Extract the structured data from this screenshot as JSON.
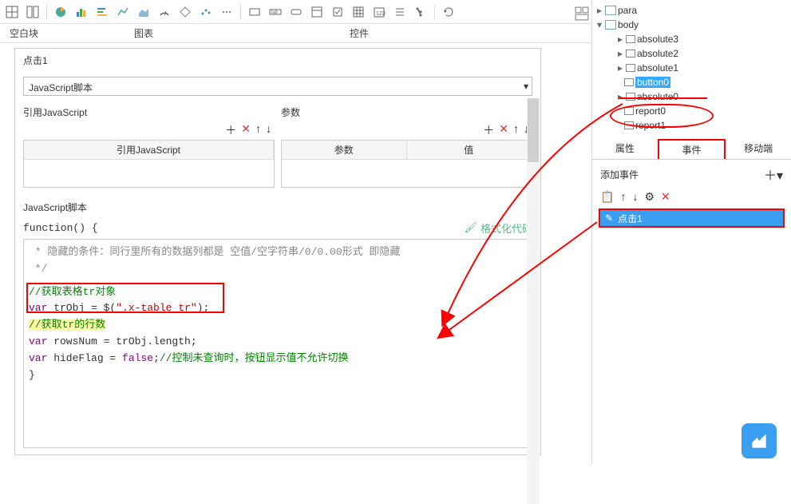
{
  "toolbar": {
    "section_blank": "空白块",
    "section_chart": "图表",
    "section_widget": "控件"
  },
  "editor": {
    "title": "点击1",
    "combo_value": "JavaScript脚本",
    "ref_js_header": "引用JavaScript",
    "param_header": "参数",
    "btns": {
      "add": "＋",
      "del": "✕",
      "up": "↑",
      "down": "↓"
    },
    "table_ref_col": "引用JavaScript",
    "table_param_col": "参数",
    "table_value_col": "值",
    "script_label": "JavaScript脚本",
    "func_line": "function() {",
    "format_btn": "格式化代码",
    "code": {
      "c1": " * 隐藏的条件：同行里所有的数据列都是 空值/空字符串/0/0.00形式 即隐藏",
      "c2": " */",
      "c3": "//获取表格tr对象",
      "c4a": "var",
      "c4b": " trObj = $(",
      "c4c": "\".x-table tr\"",
      "c4d": ");",
      "c5": "//获取tr的行数",
      "c6a": "var",
      "c6b": " rowsNum = trObj.length;",
      "c7a": "var",
      "c7b": " hideFlag = ",
      "c7c": "false",
      "c7d": ";",
      "c7e": "//控制未查询时，按钮显示值不允许切换",
      "c8": "}"
    }
  },
  "tree": {
    "para": "para",
    "body": "body",
    "items": [
      "absolute3",
      "absolute2",
      "absolute1",
      "button0",
      "absolute0",
      "report0",
      "report1"
    ]
  },
  "tabs": {
    "prop": "属性",
    "event": "事件",
    "mobile": "移动端"
  },
  "add_event": "添加事件",
  "event_btns": {
    "copy": "📋",
    "up": "↑",
    "down": "↓",
    "conf": "⚙",
    "del": "✕"
  },
  "event_item": "点击1"
}
